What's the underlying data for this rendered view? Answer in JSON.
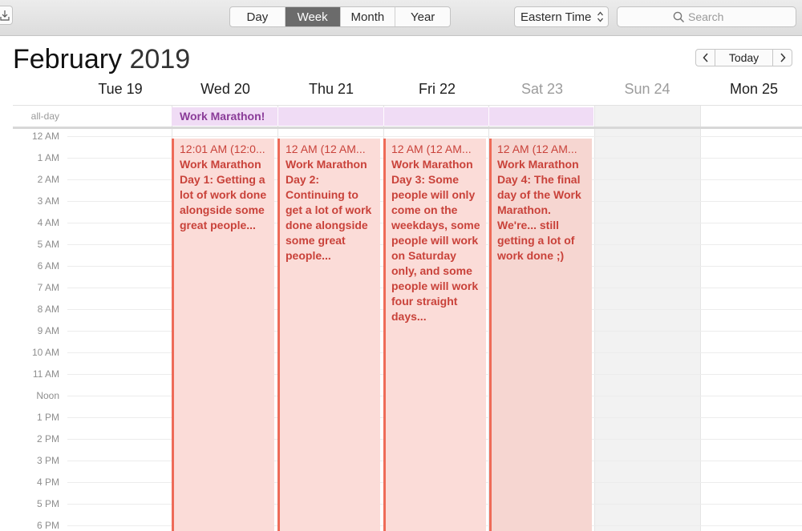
{
  "toolbar": {
    "view_tabs": [
      {
        "label": "Day",
        "active": false
      },
      {
        "label": "Week",
        "active": true
      },
      {
        "label": "Month",
        "active": false
      },
      {
        "label": "Year",
        "active": false
      }
    ],
    "timezone": "Eastern Time",
    "search_placeholder": "Search"
  },
  "header": {
    "month": "February",
    "year": "2019",
    "today_label": "Today"
  },
  "days": [
    {
      "label": "Tue 19",
      "weekend": false
    },
    {
      "label": "Wed 20",
      "weekend": false
    },
    {
      "label": "Thu 21",
      "weekend": false
    },
    {
      "label": "Fri 22",
      "weekend": false
    },
    {
      "label": "Sat 23",
      "weekend": true
    },
    {
      "label": "Sun 24",
      "weekend": true
    },
    {
      "label": "Mon 25",
      "weekend": false
    }
  ],
  "all_day": {
    "label": "all-day",
    "event_title": "Work Marathon!",
    "event_color": "#f0dcf5",
    "event_text_color": "#8a3b98"
  },
  "times": [
    "12 AM",
    "1 AM",
    "2 AM",
    "3 AM",
    "4 AM",
    "5 AM",
    "6 AM",
    "7 AM",
    "8 AM",
    "9 AM",
    "10 AM",
    "11 AM",
    "Noon",
    "1 PM",
    "2 PM",
    "3 PM",
    "4 PM",
    "5 PM",
    "6 PM"
  ],
  "events": [
    {
      "day": "Wed 20",
      "time": "12:01 AM (12:0...",
      "title": "Work Marathon Day 1: Getting a lot of work done alongside some great people..."
    },
    {
      "day": "Thu 21",
      "time": "12 AM (12 AM...",
      "title": "Work Marathon Day 2: Continuing to get a lot of work done alongside some great people..."
    },
    {
      "day": "Fri 22",
      "time": "12 AM (12 AM...",
      "title": "Work Marathon Day 3: Some people will only come on the weekdays, some people will work on Saturday only, and some people will work four straight days..."
    },
    {
      "day": "Sat 23",
      "time": "12 AM (12 AM...",
      "title": "Work Marathon Day 4: The final day of the Work Marathon. We're... still getting a lot of work done ;)"
    }
  ],
  "colors": {
    "event_bg": "#fbdcd8",
    "event_border": "#ee6b58",
    "event_text": "#c9423a",
    "active_tab": "#6b6b6b"
  },
  "icons": {
    "download": "download-icon",
    "search": "search-icon",
    "chevron_up_down": "chevron-up-down-icon",
    "prev": "chevron-left-icon",
    "next": "chevron-right-icon"
  }
}
